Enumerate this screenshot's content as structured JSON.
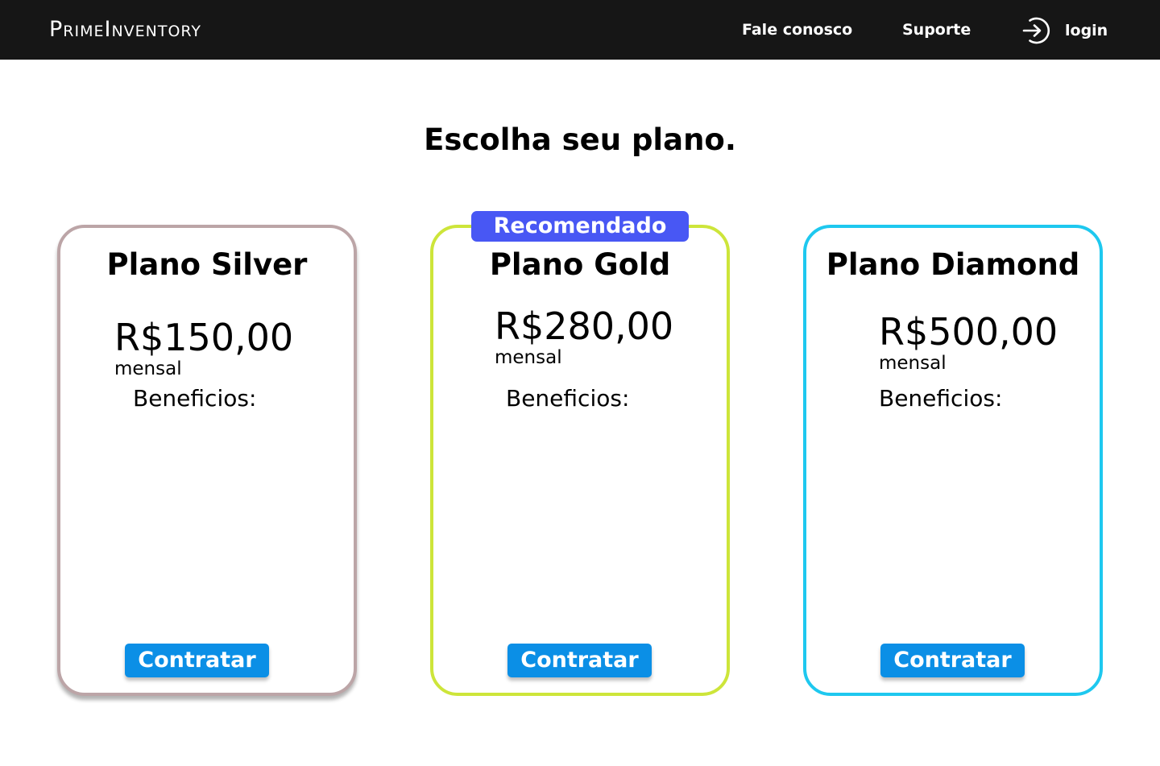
{
  "header": {
    "brand": "PrimeInventory",
    "links": {
      "contact": "Fale conosco",
      "support": "Suporte",
      "login": "login"
    },
    "login_icon": "sign-in-icon"
  },
  "page_title": "Escolha seu plano.",
  "plans": [
    {
      "name": "Plano Silver",
      "price": "R$150,00",
      "period": "mensal",
      "benefits_label": "Beneficios:",
      "cta": "Contratar",
      "border_color": "#bca5a7"
    },
    {
      "name": "Plano Gold",
      "badge": "Recomendado",
      "price": "R$280,00",
      "period": "mensal",
      "benefits_label": "Beneficios:",
      "cta": "Contratar",
      "border_color": "#cde53a"
    },
    {
      "name": "Plano Diamond",
      "price": "R$500,00",
      "period": "mensal",
      "benefits_label": "Beneficios:",
      "cta": "Contratar",
      "border_color": "#1ec8ef"
    }
  ],
  "colors": {
    "navbar_background": "#161616",
    "badge_background": "#4857f4",
    "button_background": "#0b8fe6"
  }
}
